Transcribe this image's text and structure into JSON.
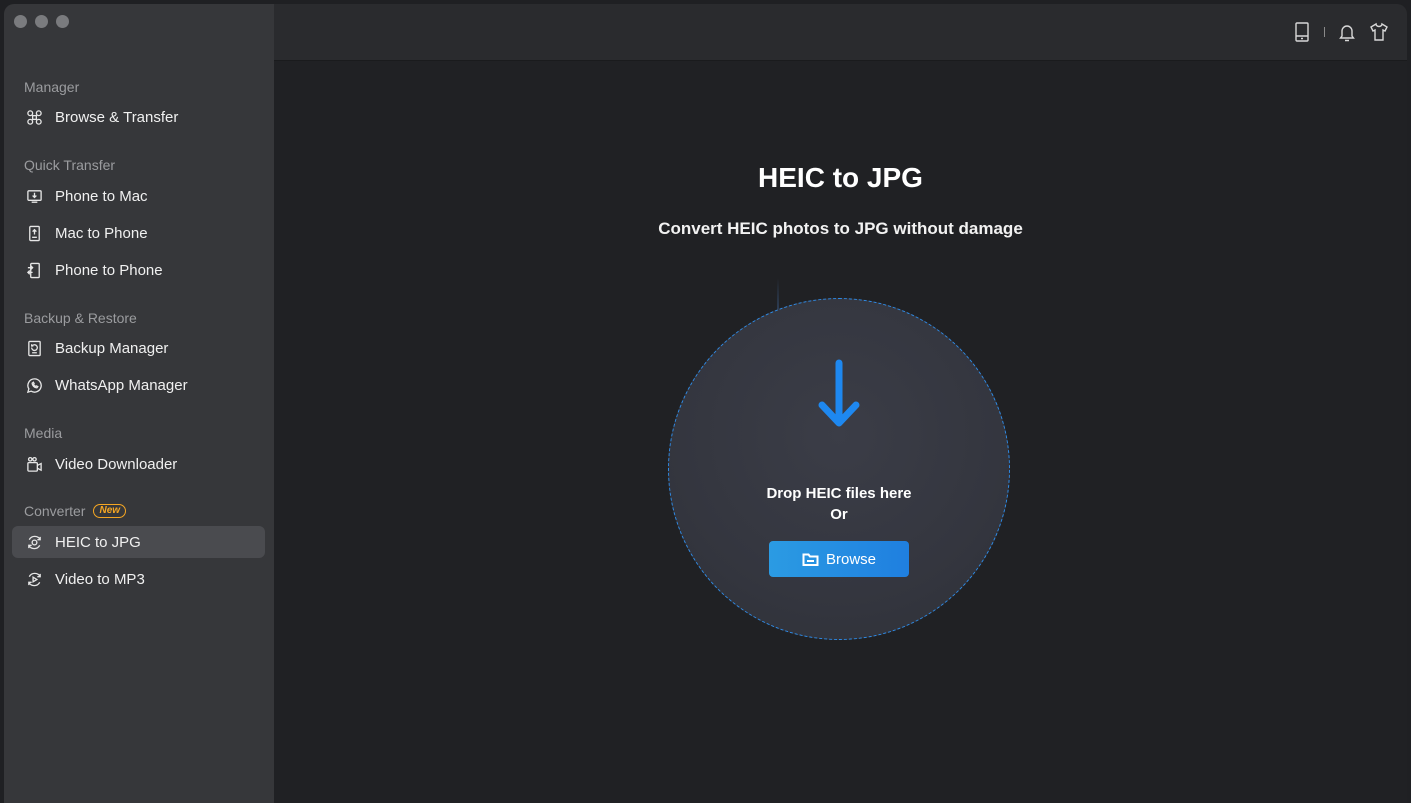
{
  "sidebar": {
    "sections": {
      "manager": "Manager",
      "quick_transfer": "Quick Transfer",
      "backup_restore": "Backup & Restore",
      "media": "Media",
      "converter": "Converter",
      "converter_badge": "New"
    },
    "items": {
      "browse_transfer": "Browse & Transfer",
      "phone_to_mac": "Phone to Mac",
      "mac_to_phone": "Mac to Phone",
      "phone_to_phone": "Phone to Phone",
      "backup_manager": "Backup Manager",
      "whatsapp_manager": "WhatsApp Manager",
      "video_downloader": "Video Downloader",
      "heic_to_jpg": "HEIC to JPG",
      "video_to_mp3": "Video to MP3"
    },
    "active_item": "heic_to_jpg"
  },
  "main": {
    "title": "HEIC to JPG",
    "subtitle": "Convert HEIC photos to JPG without damage",
    "drop_line1": "Drop HEIC files here",
    "drop_line2": "Or",
    "browse_label": "Browse"
  },
  "icons": {
    "top_right": [
      "device-icon",
      "bell-icon",
      "tshirt-icon"
    ]
  },
  "colors": {
    "accent": "#1f7fe0",
    "badge": "#f5a623"
  }
}
